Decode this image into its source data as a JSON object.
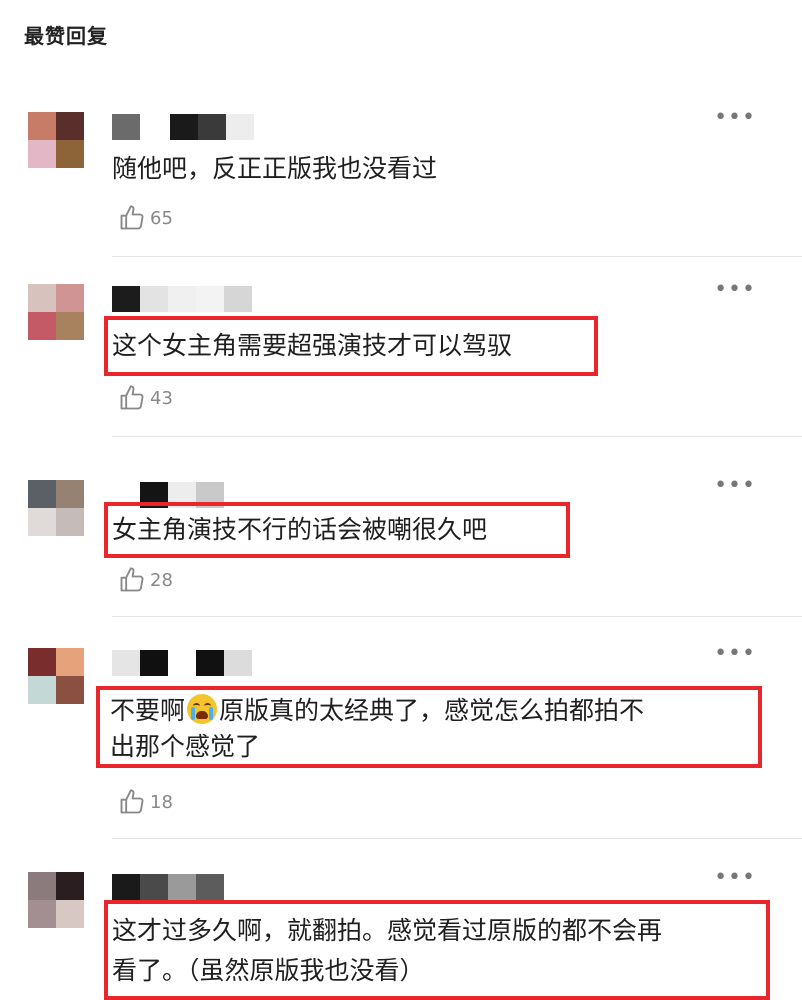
{
  "header": {
    "title": "最赞回复"
  },
  "comments": [
    {
      "avatar": [
        "#c77c68",
        "#5a2e2a",
        "#e3b7c5",
        "#8d6338"
      ],
      "name_blocks": [
        "#6b6b6b",
        "#ffffff",
        "#1a1a1a",
        "#3a3a3a",
        "#ededed"
      ],
      "text": "随他吧，反正正版我也没看过",
      "likes": "65"
    },
    {
      "avatar": [
        "#d8c2bd",
        "#d09494",
        "#c45a66",
        "#a8825f"
      ],
      "name_blocks": [
        "#1c1c1c",
        "#e3e3e3",
        "#f0f0f0",
        "#f3f3f3",
        "#d6d6d6"
      ],
      "text": "这个女主角需要超强演技才可以驾驭",
      "likes": "43"
    },
    {
      "avatar": [
        "#5b6066",
        "#958272",
        "#e0dbd8",
        "#c5bcb9"
      ],
      "name_blocks": [
        "#ffffff",
        "#141414",
        "#ededed",
        "#c9c9c9"
      ],
      "text": "女主角演技不行的话会被嘲很久吧",
      "likes": "28"
    },
    {
      "avatar": [
        "#7a2d2d",
        "#e6a27a",
        "#c4d8d6",
        "#8c5043"
      ],
      "name_blocks": [
        "#e5e5e5",
        "#101010",
        "#ffffff",
        "#111111",
        "#dcdcdc"
      ],
      "text_line1_before": "不要啊",
      "emoji": "loudly-crying-face",
      "text_line1_after": "原版真的太经典了，感觉怎么拍都拍不",
      "text_line2": "出那个感觉了",
      "likes": "18"
    },
    {
      "avatar": [
        "#8c7b7d",
        "#2b1e21",
        "#a38f91",
        "#d7c8c4"
      ],
      "name_blocks": [
        "#1a1a1a",
        "#4a4a4a",
        "#9a9a9a",
        "#5c5c5c"
      ],
      "text_line1": "这才过多久啊，就翻拍。感觉看过原版的都不会再",
      "text_line2": "看了。（虽然原版我也没看）"
    }
  ],
  "more_glyph": "•••",
  "icons": {
    "like": "thumbs-up-icon",
    "more": "more-dots-icon"
  },
  "colors": {
    "highlight": "#e8262b",
    "divider": "#e6e6e6"
  }
}
